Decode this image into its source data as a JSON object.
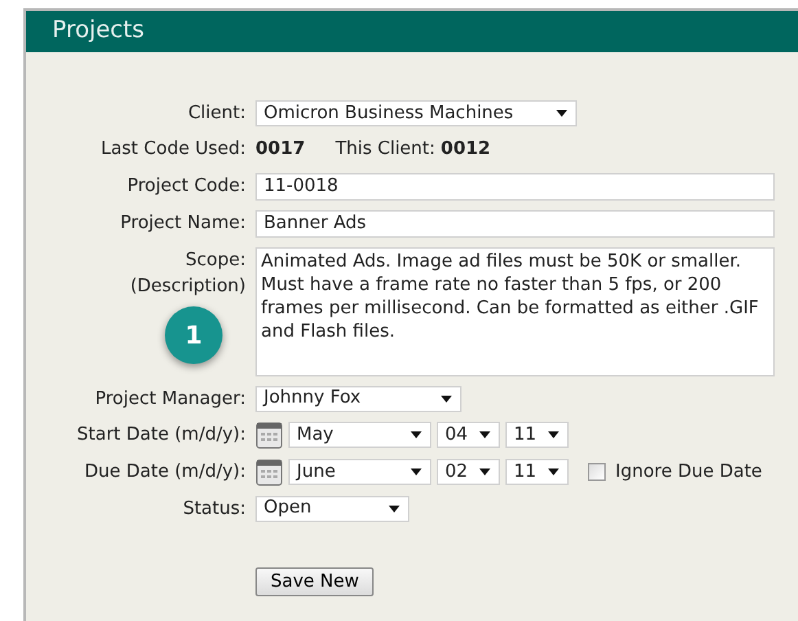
{
  "title": "Projects",
  "fields": [
    {
      "kind": "select",
      "label": "Client:",
      "value": "Omicron Business Machines"
    },
    {
      "kind": "codes",
      "label": "Last Code Used:",
      "last_code": "0017",
      "client_label": "This Client:",
      "client_code": "0012"
    },
    {
      "kind": "text",
      "label": "Project Code:",
      "value": "11-0018"
    },
    {
      "kind": "text",
      "label": "Project Name:",
      "value": "Banner Ads"
    },
    {
      "kind": "textarea",
      "label": "Scope:",
      "sublabel": "(Description)",
      "value": "Animated Ads. Image ad files must be 50K or smaller. Must have a frame rate no faster than 5 fps, or 200 frames per millisecond. Can be formatted as either .GIF and Flash files."
    },
    {
      "kind": "select",
      "label": "Project Manager:",
      "value": "Johnny Fox"
    },
    {
      "kind": "date",
      "label": "Start Date (m/d/y):",
      "month": "May",
      "day": "04",
      "year": "11"
    },
    {
      "kind": "date",
      "label": "Due Date (m/d/y):",
      "month": "June",
      "day": "02",
      "year": "11",
      "ignore": {
        "label": "Ignore Due Date",
        "checked": false
      }
    },
    {
      "kind": "select",
      "label": "Status:",
      "value": "Open"
    }
  ],
  "badge": "1",
  "save_button": "Save New"
}
